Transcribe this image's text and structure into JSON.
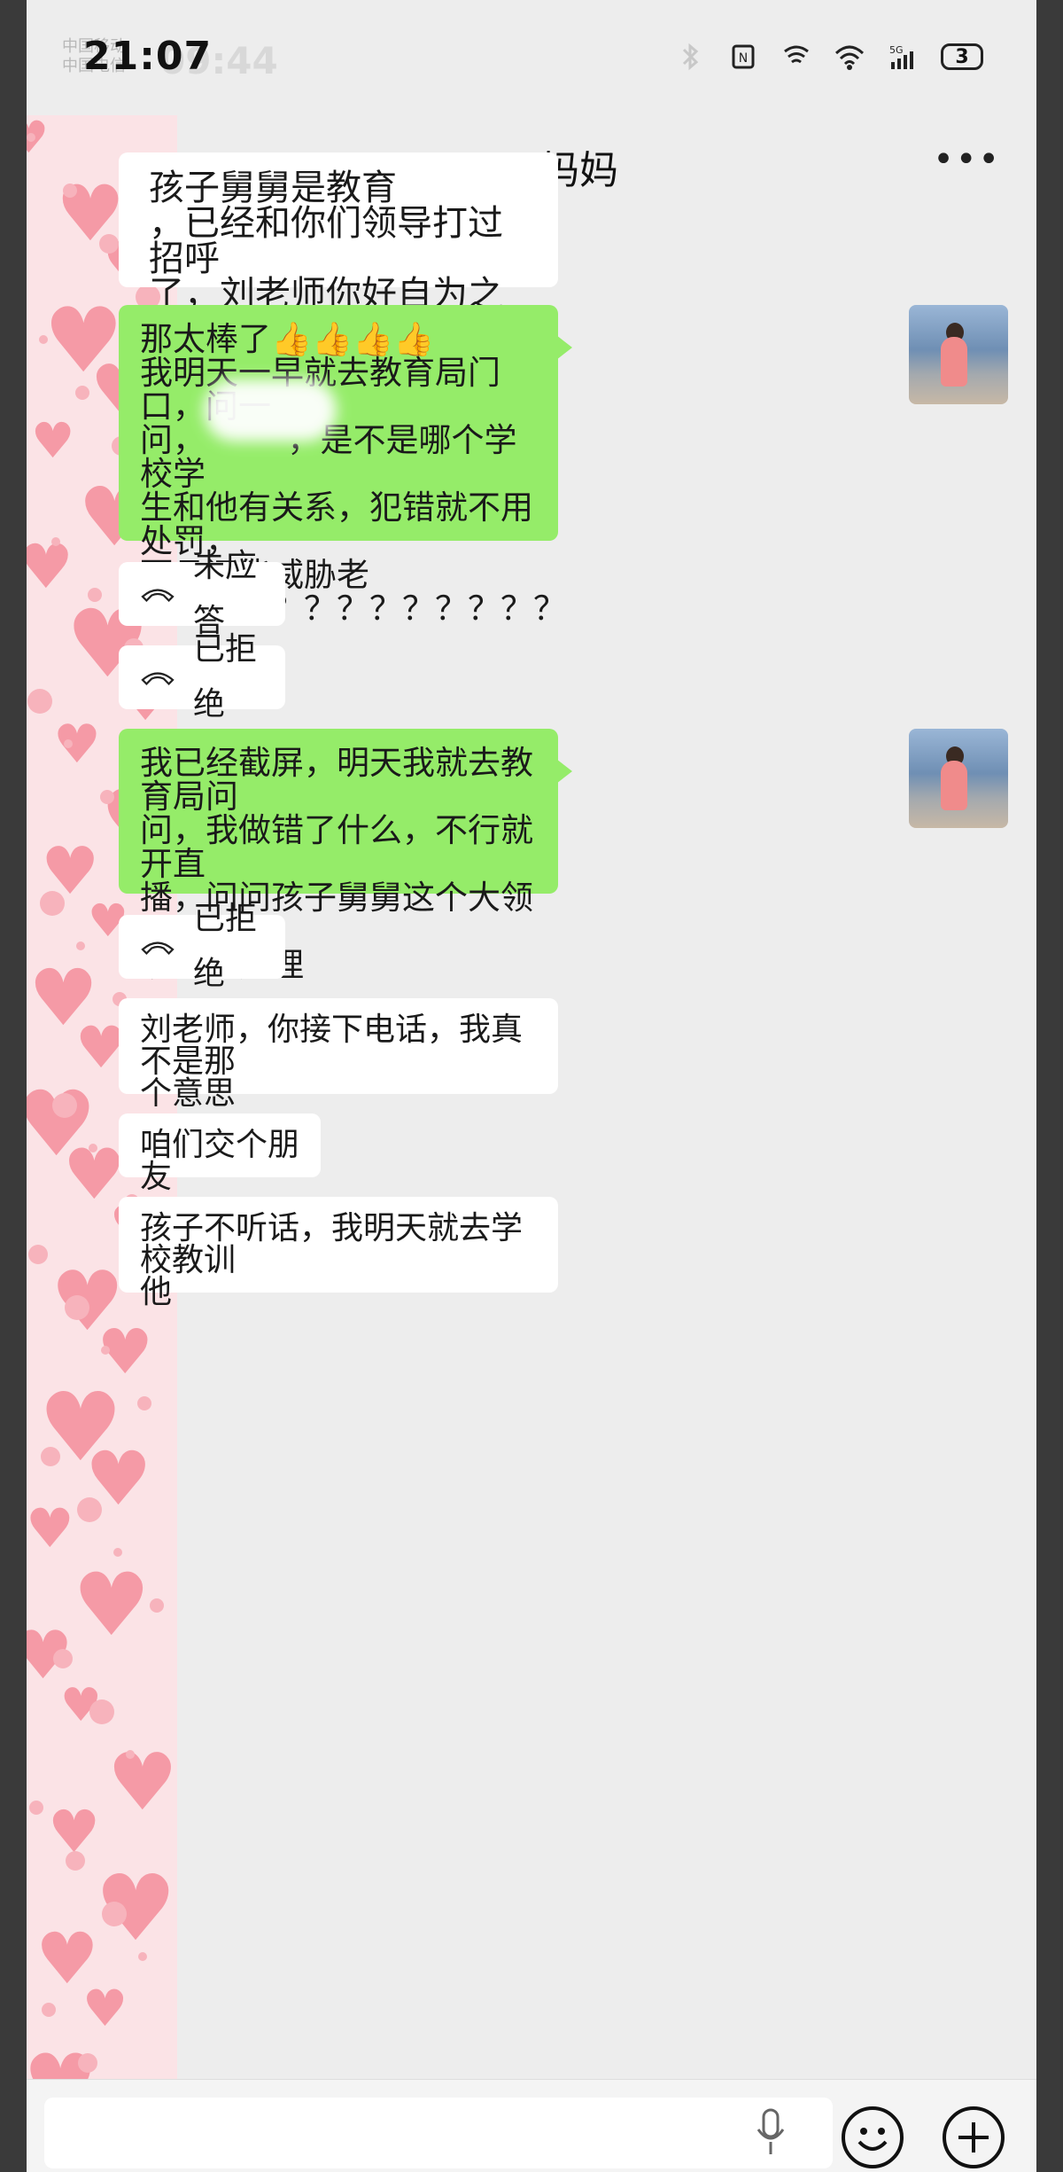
{
  "status_bar": {
    "carrier_lines": [
      "中国移动",
      "中国电信"
    ],
    "time": "21:07",
    "ghost_time": "09:44",
    "battery": "3",
    "network": "5G"
  },
  "header": {
    "title": "妈妈"
  },
  "messages": [
    {
      "side": "in",
      "type": "text",
      "text": "孩子舅舅是教育\n，已经和你们领导打过招呼\n了，刘老师你好自为之吧"
    },
    {
      "side": "out",
      "type": "text",
      "text": "那太棒了👍👍👍👍\n我明天一早就去教育局门口，问一\n问，　　　，是不是哪个学校学\n生和他有关系，犯错就不用处罚，\n而且还能威胁老\n师？？？？？？？？？？？？"
    },
    {
      "side": "in",
      "type": "call",
      "text": "未应答",
      "icon": "hangup-phone-icon"
    },
    {
      "side": "in",
      "type": "call",
      "text": "已拒绝",
      "icon": "hangup-phone-icon"
    },
    {
      "side": "out",
      "type": "text",
      "text": " 我已经截屏，明天我就去教育局问\n问，我做错了什么，不行就开直\n播，问问孩子舅舅这个大领导，我\n该怎么处理"
    },
    {
      "side": "in",
      "type": "call",
      "text": "已拒绝",
      "icon": "hangup-phone-icon"
    },
    {
      "side": "in",
      "type": "text",
      "text": "刘老师，你接下电话，我真不是那\n个意思"
    },
    {
      "side": "in",
      "type": "text",
      "text": "咱们交个朋友"
    },
    {
      "side": "in",
      "type": "text",
      "text": "孩子不听话，我明天就去学校教训\n他"
    }
  ],
  "input_bar": {
    "voice_icon": "microphone-icon",
    "emoji_icon": "smiley-icon",
    "more_icon": "plus-icon"
  },
  "colors": {
    "outgoing_bubble": "#95ec69",
    "incoming_bubble": "#ffffff",
    "chat_background": "#ededed",
    "heart": "#f59aa6"
  }
}
